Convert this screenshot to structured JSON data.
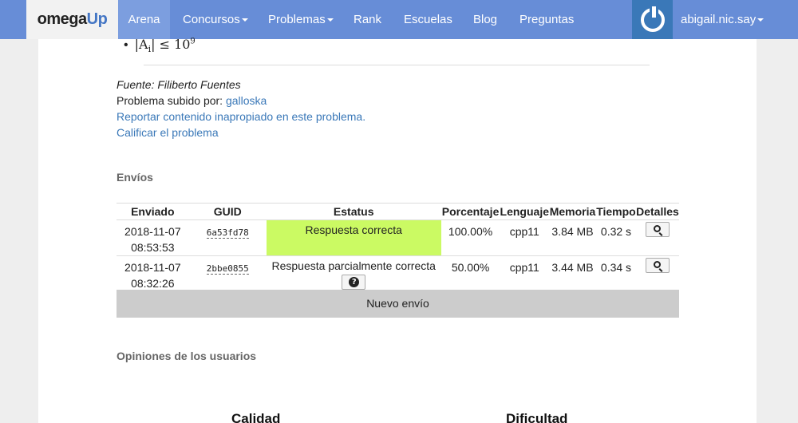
{
  "navbar": {
    "brand_part1": "omega",
    "brand_part2": "Up",
    "items": [
      "Arena",
      "Concursos",
      "Problemas",
      "Rank",
      "Escuelas",
      "Blog",
      "Preguntas"
    ],
    "user": "abigail.nic.say"
  },
  "problem": {
    "constraint_expr": "|A",
    "constraint_sub": "i",
    "constraint_rel": "| ≤ 10",
    "constraint_exp": "9",
    "source": "Fuente: Filiberto Fuentes",
    "uploaded_by_label": "Problema subido por:",
    "uploaded_by_user": "galloska",
    "report_link": "Reportar contenido inapropiado en este problema.",
    "rate_link": "Calificar el problema"
  },
  "submissions": {
    "title": "Envíos",
    "headers": [
      "Enviado",
      "GUID",
      "Estatus",
      "Porcentaje",
      "Lenguaje",
      "Memoria",
      "Tiempo",
      "Detalles"
    ],
    "rows": [
      {
        "date": "2018-11-07",
        "time": "08:53:53",
        "guid": "6a53fd78",
        "status": "Respuesta correcta",
        "percent": "100.00%",
        "language": "cpp11",
        "memory": "3.84 MB",
        "runtime": "0.32 s"
      },
      {
        "date": "2018-11-07",
        "time": "08:32:26",
        "guid": "2bbe0855",
        "status": "Respuesta parcialmente correcta",
        "percent": "50.00%",
        "language": "cpp11",
        "memory": "3.44 MB",
        "runtime": "0.34 s"
      }
    ],
    "new_run": "Nuevo envío"
  },
  "opinions": {
    "title": "Opiniones de los usuarios",
    "quality_label": "Calidad",
    "difficulty_label": "Dificultad"
  },
  "colors": {
    "navbar": "#678dd7",
    "accepted": "#cbfa63",
    "link": "#3a78b8"
  }
}
